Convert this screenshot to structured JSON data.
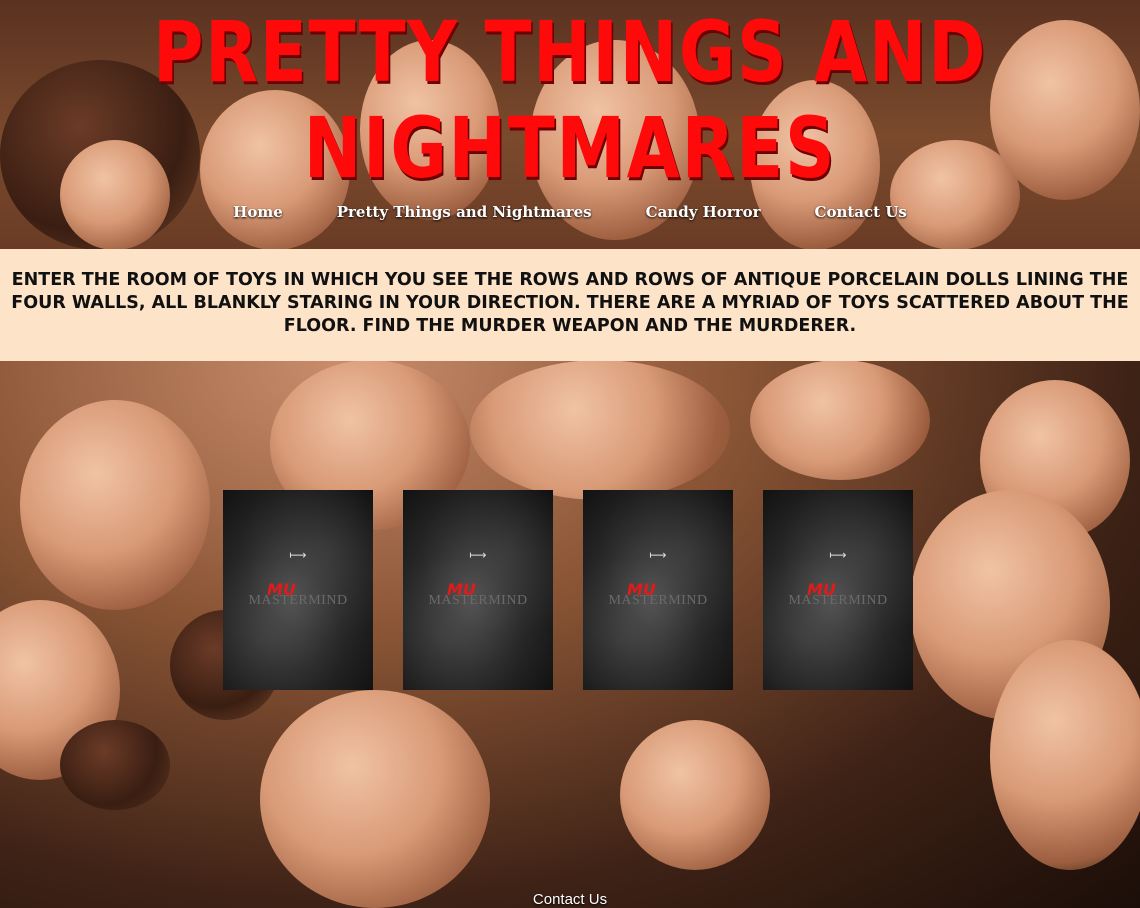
{
  "header": {
    "title": "Pretty Things and Nightmares",
    "nav": [
      "Home",
      "Pretty Things and Nightmares",
      "Candy Horror",
      "Contact Us"
    ]
  },
  "intro": {
    "text": "Enter the room of toys in which you see the rows and rows of antique porcelain dolls lining the four walls, all blankly staring in your direction. There are a myriad of toys scattered about the floor. Find the murder weapon and the murderer."
  },
  "cards": [
    {
      "arrow": "⟼",
      "logo": "MU",
      "word": "MASTERMIND"
    },
    {
      "arrow": "⟼",
      "logo": "MU",
      "word": "MASTERMIND"
    },
    {
      "arrow": "⟼",
      "logo": "MU",
      "word": "MASTERMIND"
    },
    {
      "arrow": "⟼",
      "logo": "MU",
      "word": "MASTERMIND"
    }
  ],
  "footer": {
    "label": "Contact Us"
  },
  "colors": {
    "title": "#ff0a0a",
    "intro_bg": "#fde3c8",
    "card_bg": "#1a1a1a"
  }
}
